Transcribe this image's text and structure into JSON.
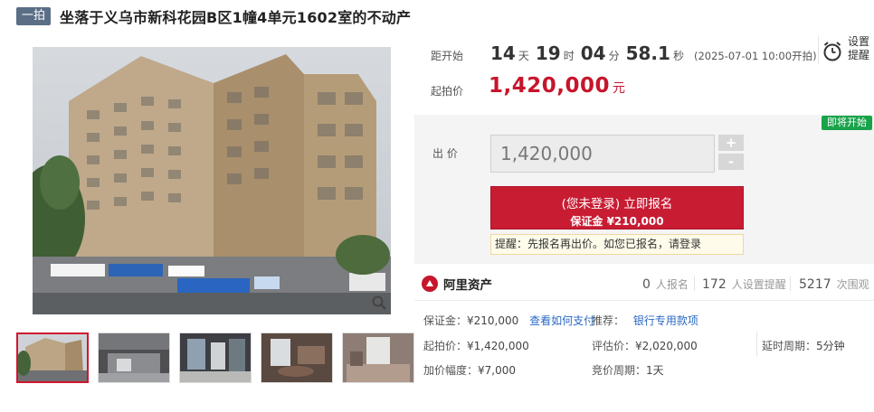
{
  "header": {
    "badge": "一拍",
    "title": "坐落于义乌市新科花园B区1幢4单元1602室的不动产"
  },
  "gallery": {
    "thumbnails": [
      {
        "name": "building-exterior"
      },
      {
        "name": "living-room"
      },
      {
        "name": "kitchen"
      },
      {
        "name": "dining-room"
      },
      {
        "name": "bedroom"
      }
    ]
  },
  "timer": {
    "label": "距开始",
    "days": "14",
    "days_unit": "天",
    "hours": "19",
    "hours_unit": "时",
    "minutes": "04",
    "minutes_unit": "分",
    "seconds": "58.1",
    "seconds_unit": "秒",
    "note": "(2025-07-01 10:00开拍)"
  },
  "start_price": {
    "label": "起拍价",
    "value": "1,420,000",
    "unit": "元"
  },
  "reminder": {
    "line1": "设置",
    "line2": "提醒"
  },
  "bid": {
    "status_tag": "即将开始",
    "label": "出 价",
    "value": "1,420,000",
    "plus": "+",
    "minus": "-",
    "signup_line1": "(您未登录) 立即报名",
    "signup_line2": "保证金 ¥210,000",
    "tip": "提醒：先报名再出价。如您已报名，请登录"
  },
  "stats": {
    "brand": "阿里资产",
    "registered_count": "0",
    "registered_label": "人报名",
    "reminder_count": "172",
    "reminder_label": "人设置提醒",
    "views_count": "5217",
    "views_label": "次围观"
  },
  "details": {
    "deposit_label": "保证金：",
    "deposit_value": "¥210,000",
    "deposit_link": "查看如何支付",
    "recommend_label": "推荐：",
    "recommend_link": "银行专用款项",
    "start_price_label": "起拍价：",
    "start_price_value": "¥1,420,000",
    "appraisal_label": "评估价：",
    "appraisal_value": "¥2,020,000",
    "delay_label": "延时周期：",
    "delay_value": "5分钟",
    "increment_label": "加价幅度：",
    "increment_value": "¥7,000",
    "cycle_label": "竞价周期：",
    "cycle_value": "1天"
  },
  "colors": {
    "price_red": "#c7152c",
    "badge_slate": "#5a6e86",
    "soon_green": "#19a34a",
    "link_blue": "#2a68c4"
  }
}
